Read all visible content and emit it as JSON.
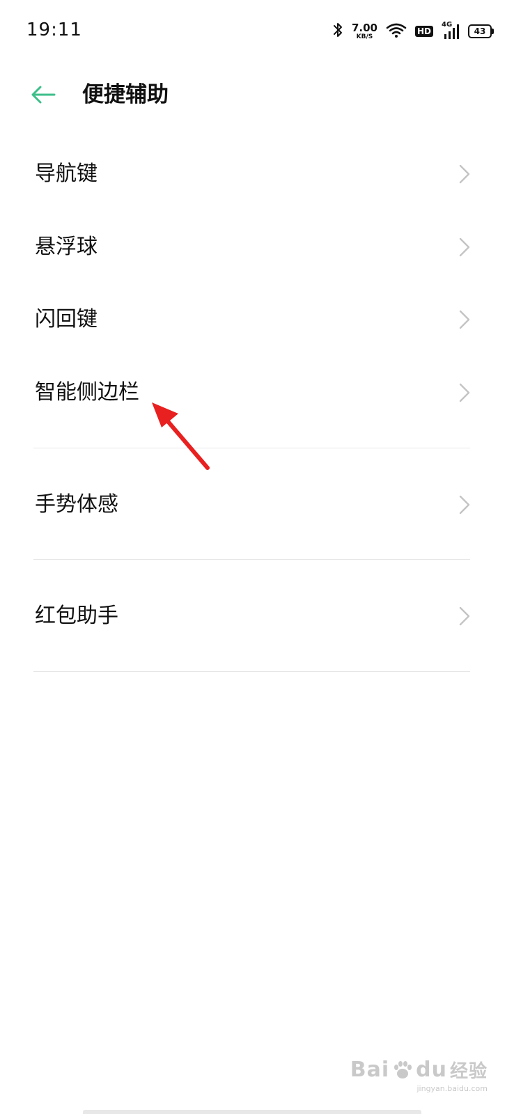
{
  "status_bar": {
    "time": "19:11",
    "net_speed_value": "7.00",
    "net_speed_unit": "KB/S",
    "hd_label": "HD",
    "network_type": "4G",
    "battery_level": "43"
  },
  "header": {
    "title": "便捷辅助"
  },
  "menu": {
    "items": [
      {
        "label": "导航键"
      },
      {
        "label": "悬浮球"
      },
      {
        "label": "闪回键"
      },
      {
        "label": "智能侧边栏"
      },
      {
        "label": "手势体感"
      },
      {
        "label": "红包助手"
      }
    ]
  },
  "colors": {
    "accent": "#3dbf8a",
    "annotation": "#e8201f",
    "divider": "#e6e6e6",
    "chevron": "#c4c4c4"
  },
  "watermark": {
    "logo_text_left": "Bai",
    "logo_text_mid": "du",
    "logo_text_right": "经验",
    "url": "jingyan.baidu.com"
  }
}
